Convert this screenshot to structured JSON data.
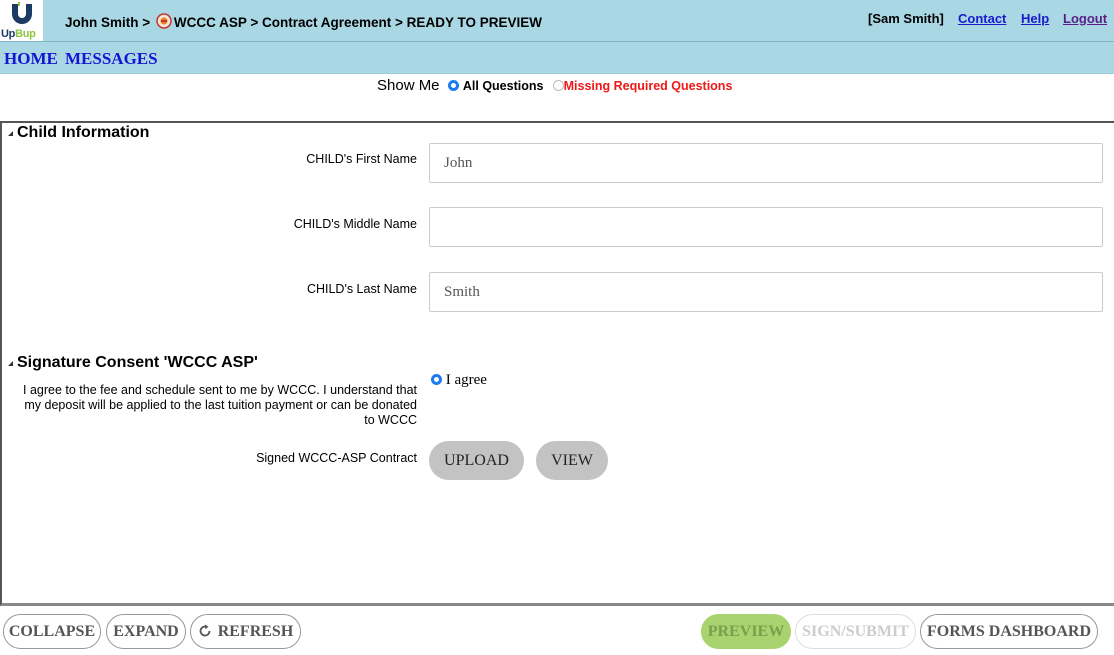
{
  "header": {
    "logo_text_up": "Up",
    "logo_text_bup": "Bup",
    "breadcrumb_before": "John Smith > ",
    "breadcrumb_after": "WCCC ASP > Contract Agreement > READY TO PREVIEW",
    "user": "[Sam Smith]",
    "links": {
      "contact": "Contact",
      "help": "Help",
      "logout": "Logout"
    }
  },
  "nav": {
    "home": "HOME",
    "messages": "MESSAGES"
  },
  "filter": {
    "label": "Show Me",
    "all": "All Questions",
    "missing": "Missing Required Questions",
    "selected": "all"
  },
  "sections": {
    "child": {
      "title": "Child Information",
      "first_name_label": "CHILD's First Name",
      "first_name_value": "John",
      "middle_name_label": "CHILD's Middle Name",
      "middle_name_value": "",
      "last_name_label": "CHILD's Last Name",
      "last_name_value": "Smith"
    },
    "signature": {
      "title": "Signature Consent 'WCCC ASP'",
      "consent_text": "I agree to the fee and schedule sent to me by WCCC. I understand that my deposit will be applied to the last tuition payment or can be donated to WCCC",
      "agree_label": "I agree",
      "contract_label": "Signed WCCC-ASP Contract",
      "upload": "UPLOAD",
      "view": "VIEW"
    }
  },
  "footer": {
    "collapse": "COLLAPSE",
    "expand": "EXPAND",
    "refresh": "REFRESH",
    "preview": "PREVIEW",
    "sign_submit": "SIGN/SUBMIT",
    "forms_dashboard": "FORMS DASHBOARD"
  },
  "colors": {
    "header_bg": "#a9d7e4",
    "link_blue": "#1a1acc",
    "missing_red": "#f01818",
    "preview_green": "#a8d36f",
    "radio_blue": "#1a7cf0"
  }
}
